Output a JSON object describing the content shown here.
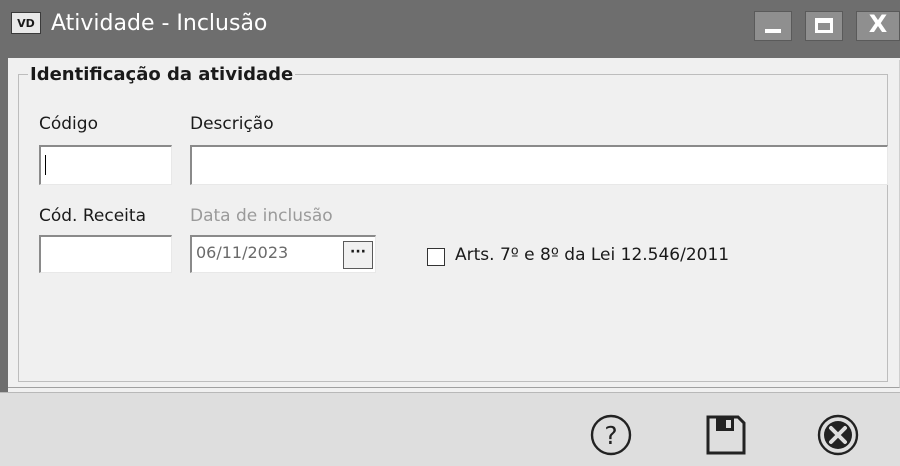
{
  "window": {
    "app_icon_text": "VD",
    "title": "Atividade - Inclusão",
    "titlebar_color": "#6e6e6e",
    "controls": {
      "minimize_icon": "minimize-icon",
      "maximize_icon": "maximize-icon",
      "close_label": "X"
    }
  },
  "form": {
    "group_title": "Identificação da atividade",
    "codigo": {
      "label": "Código",
      "value": ""
    },
    "descricao": {
      "label": "Descrição",
      "value": ""
    },
    "cod_receita": {
      "label": "Cód. Receita",
      "value": ""
    },
    "data_inclusao": {
      "label": "Data de inclusão",
      "value": "06/11/2023",
      "button_label": "···"
    },
    "checkbox": {
      "label": "Arts. 7º e 8º da Lei 12.546/2011",
      "checked": false
    }
  },
  "footer": {
    "help_icon": "help-icon",
    "save_icon": "save-icon",
    "cancel_icon": "cancel-icon"
  }
}
